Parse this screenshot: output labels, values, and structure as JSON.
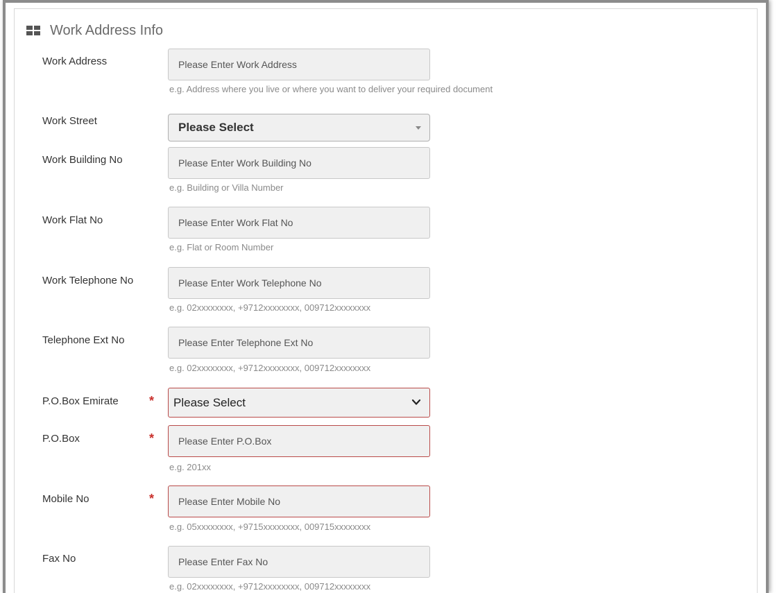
{
  "section": {
    "title": "Work Address Info",
    "icon": "grid-icon"
  },
  "fields": {
    "work_address": {
      "label": "Work Address",
      "placeholder": "Please Enter Work Address",
      "hint": "e.g. Address where you live or where you want to deliver your required document"
    },
    "work_street": {
      "label": "Work Street",
      "selected": "Please Select"
    },
    "work_building_no": {
      "label": "Work Building No",
      "placeholder": "Please Enter Work Building No",
      "hint": "e.g. Building or Villa Number"
    },
    "work_flat_no": {
      "label": "Work Flat No",
      "placeholder": "Please Enter Work Flat No",
      "hint": "e.g. Flat or Room Number"
    },
    "work_telephone_no": {
      "label": "Work Telephone No",
      "placeholder": "Please Enter Work Telephone No",
      "hint": "e.g. 02xxxxxxxx, +9712xxxxxxxx, 009712xxxxxxxx"
    },
    "telephone_ext_no": {
      "label": "Telephone Ext No",
      "placeholder": "Please Enter Telephone Ext No",
      "hint": "e.g. 02xxxxxxxx, +9712xxxxxxxx, 009712xxxxxxxx"
    },
    "po_box_emirate": {
      "label": "P.O.Box Emirate",
      "required_mark": "*",
      "selected": "Please Select"
    },
    "po_box": {
      "label": "P.O.Box",
      "required_mark": "*",
      "placeholder": "Please Enter P.O.Box",
      "hint": "e.g. 201xx"
    },
    "mobile_no": {
      "label": "Mobile No",
      "required_mark": "*",
      "placeholder": "Please Enter Mobile No",
      "hint": "e.g. 05xxxxxxxx, +9715xxxxxxxx, 009715xxxxxxxx"
    },
    "fax_no": {
      "label": "Fax No",
      "placeholder": "Please Enter Fax No",
      "hint": "e.g. 02xxxxxxxx, +9712xxxxxxxx, 009712xxxxxxxx"
    }
  },
  "colors": {
    "required": "#c9302c",
    "error_border": "#b94a48",
    "input_bg": "#f0f0f0"
  }
}
